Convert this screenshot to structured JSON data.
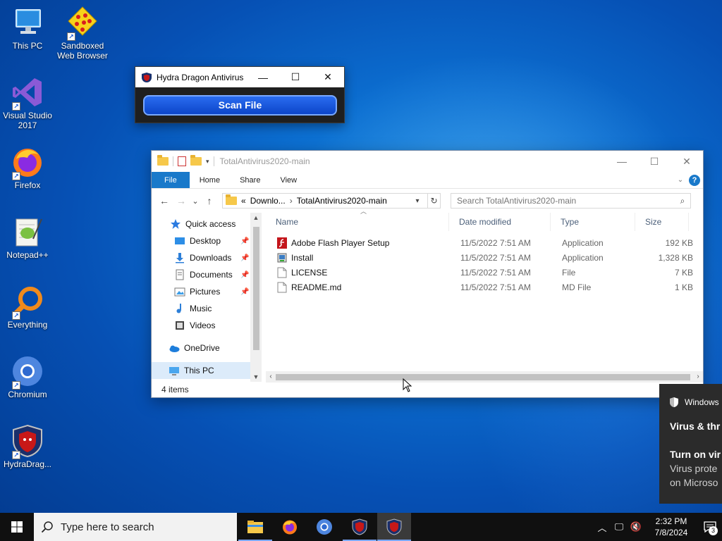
{
  "desktop": {
    "icons": [
      {
        "label": "This PC",
        "icon": "computer-icon"
      },
      {
        "label": "Sandboxed Web Browser",
        "icon": "sandboxie-icon"
      },
      {
        "label": "Visual Studio 2017",
        "icon": "visual-studio-icon"
      },
      {
        "label": "Firefox",
        "icon": "firefox-icon"
      },
      {
        "label": "Notepad++",
        "icon": "notepadpp-icon"
      },
      {
        "label": "Everything",
        "icon": "everything-icon"
      },
      {
        "label": "Chromium",
        "icon": "chromium-icon"
      },
      {
        "label": "HydraDrag...",
        "icon": "hydra-dragon-icon"
      }
    ]
  },
  "hydra_window": {
    "title": "Hydra Dragon Antivirus",
    "minimize": "—",
    "maximize": "☐",
    "close": "✕",
    "scan_button": "Scan File"
  },
  "explorer": {
    "title": "TotalAntivirus2020-main",
    "ribbon_tabs": [
      "File",
      "Home",
      "Share",
      "View"
    ],
    "nav": {
      "back": "←",
      "forward": "→",
      "recent": "⌄",
      "up": "↑"
    },
    "address": {
      "prefix": "«",
      "parent": "Downlo...",
      "separator": "›",
      "current": "TotalAntivirus2020-main"
    },
    "search_placeholder": "Search TotalAntivirus2020-main",
    "nav_pane": {
      "quick_access": "Quick access",
      "items": [
        {
          "label": "Desktop",
          "pinned": true
        },
        {
          "label": "Downloads",
          "pinned": true
        },
        {
          "label": "Documents",
          "pinned": true
        },
        {
          "label": "Pictures",
          "pinned": true
        },
        {
          "label": "Music",
          "pinned": false
        },
        {
          "label": "Videos",
          "pinned": false
        }
      ],
      "onedrive": "OneDrive",
      "this_pc": "This PC"
    },
    "columns": [
      "Name",
      "Date modified",
      "Type",
      "Size"
    ],
    "files": [
      {
        "name": "Adobe Flash Player Setup",
        "date": "11/5/2022 7:51 AM",
        "type": "Application",
        "size": "192 KB",
        "icon": "flash-icon"
      },
      {
        "name": "Install",
        "date": "11/5/2022 7:51 AM",
        "type": "Application",
        "size": "1,328 KB",
        "icon": "installer-icon"
      },
      {
        "name": "LICENSE",
        "date": "11/5/2022 7:51 AM",
        "type": "File",
        "size": "7 KB",
        "icon": "file-icon"
      },
      {
        "name": "README.md",
        "date": "11/5/2022 7:51 AM",
        "type": "MD File",
        "size": "1 KB",
        "icon": "file-icon"
      }
    ],
    "status": "4 items"
  },
  "toast": {
    "app": "Windows",
    "heading": "Virus & thr",
    "line1": "Turn on vir",
    "line2": "Virus prote",
    "line3": "on Microso"
  },
  "taskbar": {
    "search_placeholder": "Type here to search",
    "time": "2:32 PM",
    "date": "7/8/2024",
    "notification_count": "3"
  },
  "colors": {
    "accent": "#1979ca",
    "scan_button": "#1a56dc",
    "taskbar": "#101010"
  }
}
